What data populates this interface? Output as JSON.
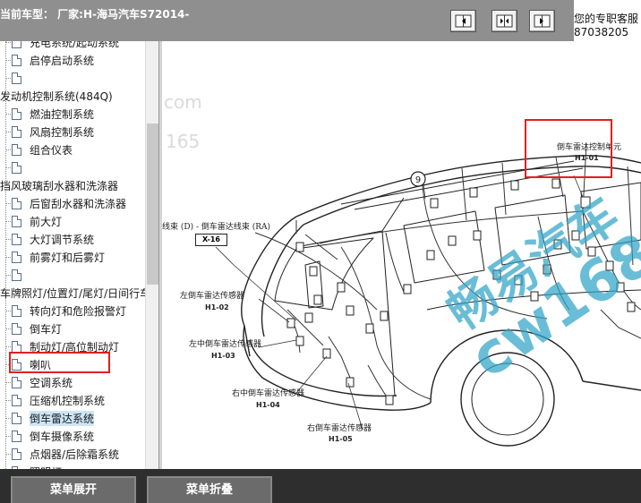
{
  "header": {
    "model_label": "当前车型：  厂家:H-海马汽车S72014-",
    "hotline_line1": "您的专职客服",
    "hotline_line2": "87038205",
    "nav_buttons": [
      {
        "icon": "go-left-icon"
      },
      {
        "icon": "fit-horizontal-icon"
      },
      {
        "icon": "go-right-icon"
      }
    ]
  },
  "sidebar": {
    "items": [
      {
        "label": "充电系统/起动系统"
      },
      {
        "label": "启停启动系统"
      },
      {
        "label": ""
      },
      {
        "label": "发动机控制系统(484Q)"
      },
      {
        "label": "燃油控制系统"
      },
      {
        "label": "风扇控制系统"
      },
      {
        "label": "组合仪表"
      },
      {
        "label": ""
      },
      {
        "label": "挡风玻璃刮水器和洗涤器"
      },
      {
        "label": "后窗刮水器和洗涤器"
      },
      {
        "label": "前大灯"
      },
      {
        "label": "大灯调节系统"
      },
      {
        "label": "前雾灯和后雾灯"
      },
      {
        "label": ""
      },
      {
        "label": "车牌照灯/位置灯/尾灯/日间行车灯"
      },
      {
        "label": "转向灯和危险报警灯"
      },
      {
        "label": "倒车灯"
      },
      {
        "label": "制动灯/高位制动灯"
      },
      {
        "label": "喇叭"
      },
      {
        "label": "空调系统"
      },
      {
        "label": "压缩机控制系统"
      },
      {
        "label": "倒车雷达系统"
      },
      {
        "label": "倒车摄像系统"
      },
      {
        "label": "点烟器/后除霜系统"
      },
      {
        "label": "照明灯"
      }
    ],
    "selected_index": 21
  },
  "diagram": {
    "harness_label": "线束 (D) - 倒车雷达线束 (RA)",
    "harness_code": "X-16",
    "circle_marker": "9",
    "unit_label": "倒车雷达控制单元",
    "unit_code": "H1-01",
    "sensors": [
      {
        "label": "左倒车雷达传感器",
        "code": "H1-02"
      },
      {
        "label": "左中倒车雷达传感器",
        "code": "H1-03"
      },
      {
        "label": "右中倒车雷达传感器",
        "code": "H1-04"
      },
      {
        "label": "右倒车雷达传感器",
        "code": "H1-05"
      }
    ],
    "watermark_site_1": "com",
    "watermark_site_2": "165",
    "watermark_line1": "畅易汽车",
    "watermark_line2": "cw168"
  },
  "footer": {
    "expand_label": "菜单展开",
    "collapse_label": "菜单折叠"
  },
  "colors": {
    "highlight_red": "#e02020",
    "watermark_blue": "#30a3c6",
    "toolbar_gray": "#8f8f8f",
    "footer_dark": "#2e2e2e"
  }
}
